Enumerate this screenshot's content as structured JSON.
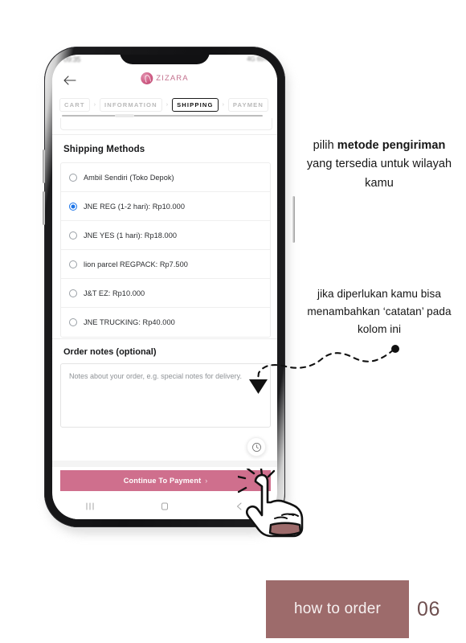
{
  "phone": {
    "status_bar": {
      "time": "09:35",
      "right_info": "4G 65%"
    },
    "app_header": {
      "back_icon": "back-arrow-icon",
      "brand_name": "ZIZARA",
      "brand_mark_icon": "zizara-logo-icon"
    },
    "breadcrumb": {
      "items": [
        {
          "label": "CART",
          "active": false
        },
        {
          "label": "INFORMATION",
          "active": false
        },
        {
          "label": "SHIPPING",
          "active": true
        },
        {
          "label": "PAYMEN",
          "active": false
        }
      ],
      "separator": "›"
    },
    "shipping": {
      "section_title": "Shipping Methods",
      "options": [
        {
          "label": "Ambil Sendiri (Toko Depok)",
          "selected": false
        },
        {
          "label": "JNE REG (1-2 hari): Rp10.000",
          "selected": true
        },
        {
          "label": "JNE YES (1 hari): Rp18.000",
          "selected": false
        },
        {
          "label": "lion parcel REGPACK: Rp7.500",
          "selected": false
        },
        {
          "label": "J&T EZ: Rp10.000",
          "selected": false
        },
        {
          "label": "JNE TRUCKING: Rp40.000",
          "selected": false
        }
      ]
    },
    "order_notes": {
      "title": "Order notes (optional)",
      "placeholder": "Notes about your order, e.g. special notes for delivery.",
      "value": ""
    },
    "history_fab_icon": "clock-icon",
    "cta": {
      "label": "Continue To Payment",
      "chevron": "›"
    },
    "nav_bar": {
      "recents_icon": "recents-icon",
      "home_icon": "home-icon",
      "back_icon": "back-icon"
    }
  },
  "annotations": {
    "shipping_note": {
      "part1": "pilih ",
      "bold": "metode pengiriman",
      "part2": " yang tersedia untuk wilayah kamu"
    },
    "notes_note": "jika diperlukan kamu bisa menambahkan ‘catatan’ pada kolom ini",
    "pointer_icon": "dashed-arrow-icon",
    "hand_cursor_icon": "pointing-hand-cursor-icon"
  },
  "footer": {
    "label": "how to order",
    "page_number": "06"
  },
  "colors": {
    "cta_pink": "#cf6f8d",
    "footer_badge": "#9d6b6b",
    "footer_number": "#6f5050",
    "radio_selected": "#1a73e8",
    "brand_pink": "#c3718e"
  }
}
